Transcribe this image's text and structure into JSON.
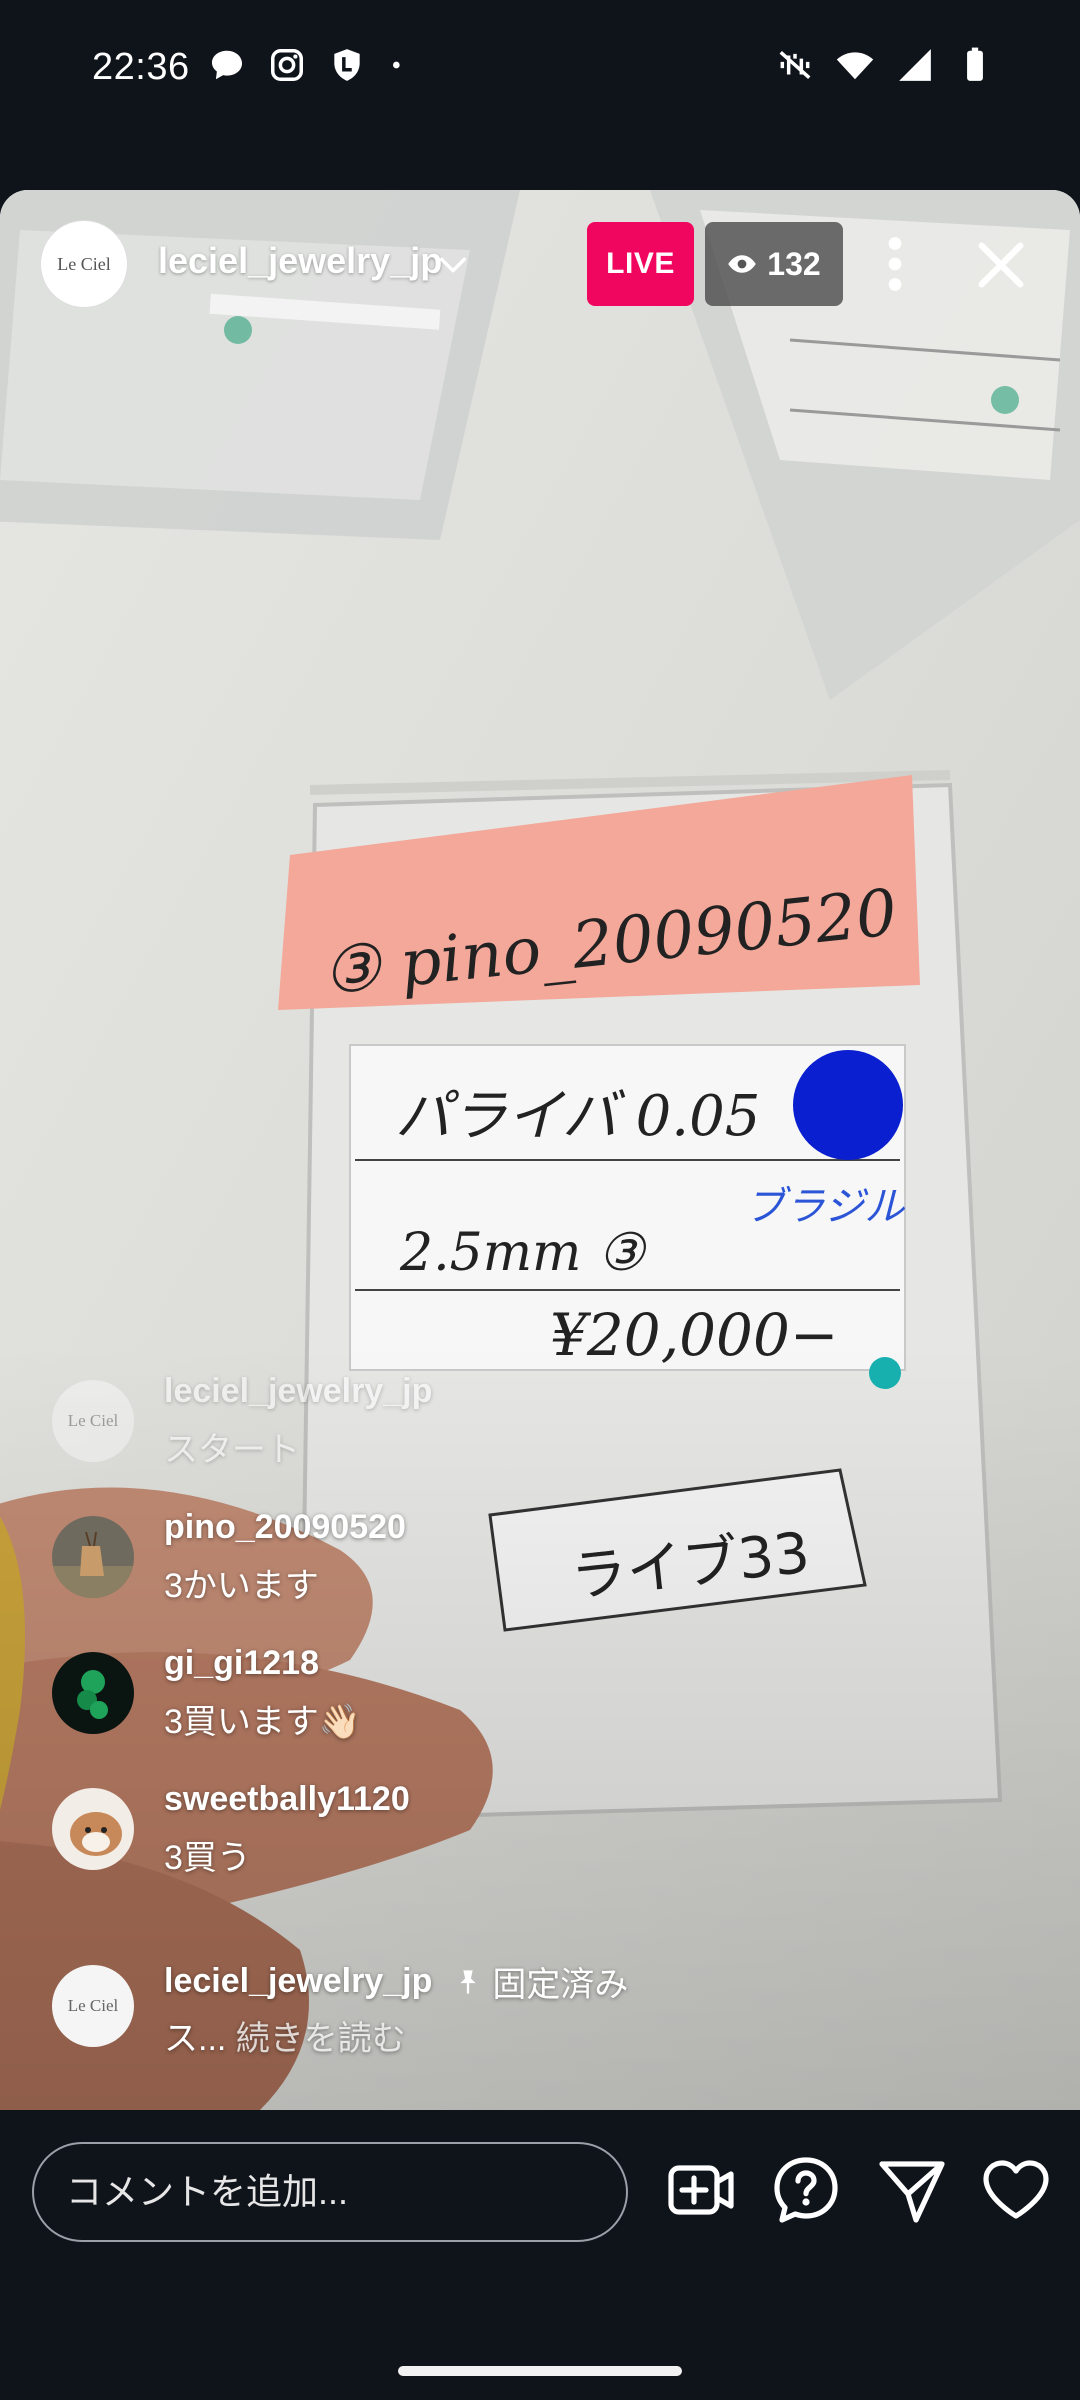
{
  "status_bar": {
    "time": "22:36",
    "left_icons": [
      "chat-bubble-icon",
      "instagram-icon",
      "shield-l-icon",
      "dot-icon"
    ],
    "right_icons": [
      "vibrate-off-icon",
      "wifi-icon",
      "signal-icon",
      "battery-icon"
    ]
  },
  "header": {
    "host_username": "leciel_jewelry_jp",
    "host_avatar_text": "Le Ciel",
    "live_label": "LIVE",
    "viewer_count": "132"
  },
  "video_overlay": {
    "card_title": "③ pino_20090520",
    "line1": "パライバ 0.05",
    "line2_left": "2.5mm",
    "line2_mid": "③",
    "line2_right": "ブラジル",
    "price": "¥20,000−",
    "tag": "ライブ33"
  },
  "comments": [
    {
      "username": "leciel_jewelry_jp",
      "text": "スタート",
      "avatar": "leciel-logo"
    },
    {
      "username": "pino_20090520",
      "text": "3かいます",
      "avatar": "deer-photo"
    },
    {
      "username": "gi_gi1218",
      "text": "3買います👋🏻",
      "avatar": "green-jewel"
    },
    {
      "username": "sweetbally1120",
      "text": "3買う",
      "avatar": "dog-photo"
    }
  ],
  "pinned_comment": {
    "username": "leciel_jewelry_jp",
    "pinned_label": "固定済み",
    "text": "ス...",
    "read_more": "続きを読む"
  },
  "bottom_bar": {
    "comment_placeholder": "コメントを追加...",
    "icons": [
      "add-video-icon",
      "question-icon",
      "send-icon",
      "heart-icon"
    ]
  },
  "colors": {
    "live_badge": "#f0065e",
    "background": "#0f131a"
  }
}
